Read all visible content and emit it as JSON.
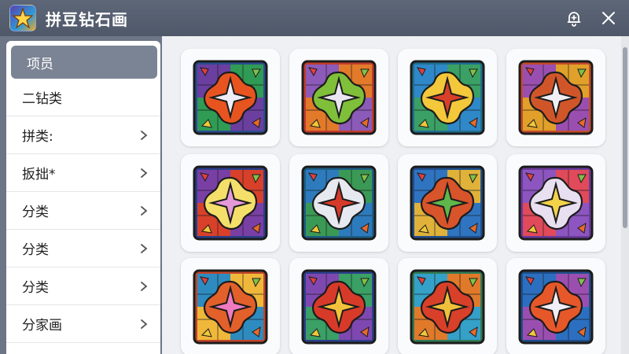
{
  "window": {
    "title": "拼豆钻石画",
    "icons": {
      "app": "app-star-icon",
      "bell": "bell-plus-icon",
      "close": "close-icon"
    }
  },
  "sidebar": {
    "items": [
      {
        "label": "项员",
        "active": true,
        "has_chevron": false
      },
      {
        "label": "二钻类",
        "active": false,
        "has_chevron": false
      },
      {
        "label": "拼类:",
        "active": false,
        "has_chevron": true
      },
      {
        "label": "扳拙*",
        "active": false,
        "has_chevron": true
      },
      {
        "label": "分类",
        "active": false,
        "has_chevron": true
      },
      {
        "label": "分类",
        "active": false,
        "has_chevron": true
      },
      {
        "label": "分类",
        "active": false,
        "has_chevron": true
      },
      {
        "label": "分家画",
        "active": false,
        "has_chevron": true
      }
    ]
  },
  "grid": {
    "tiles": [
      {
        "frame": "#2a4d8f",
        "star": "#f0eef5",
        "blob": "#e8541f",
        "bg1": "#6a3fa0",
        "bg2": "#2f9b55"
      },
      {
        "frame": "#c23b2b",
        "star": "#e9e6f2",
        "blob": "#7fbf3a",
        "bg1": "#8c5ab8",
        "bg2": "#e27a2a"
      },
      {
        "frame": "#1f6e8f",
        "star": "#d8402a",
        "blob": "#f3c83a",
        "bg1": "#2f88c8",
        "bg2": "#3aa065"
      },
      {
        "frame": "#c44a2a",
        "star": "#f1eff6",
        "blob": "#d0562a",
        "bg1": "#9a4fb0",
        "bg2": "#e0a02a"
      },
      {
        "frame": "#2a3e8a",
        "star": "#e49ad8",
        "blob": "#f4df6a",
        "bg1": "#7a3fa5",
        "bg2": "#d8402a"
      },
      {
        "frame": "#1c5f86",
        "star": "#d63a2a",
        "blob": "#e6e9ef",
        "bg1": "#2d7bbd",
        "bg2": "#3a9a55"
      },
      {
        "frame": "#1f4f8e",
        "star": "#5fb64a",
        "blob": "#d8542a",
        "bg1": "#2f74c0",
        "bg2": "#e0b23a"
      },
      {
        "frame": "#6a3a9a",
        "star": "#f3d24a",
        "blob": "#e8e0f0",
        "bg1": "#8d55c0",
        "bg2": "#e04a5a"
      },
      {
        "frame": "#c2452a",
        "star": "#f07ac0",
        "blob": "#e2602a",
        "bg1": "#2e8bc0",
        "bg2": "#f0b83a"
      },
      {
        "frame": "#2c3f8c",
        "star": "#f4c23a",
        "blob": "#d83a2a",
        "bg1": "#7f48b0",
        "bg2": "#3aa065"
      },
      {
        "frame": "#2f7a55",
        "star": "#f0c03a",
        "blob": "#d8402a",
        "bg1": "#35a0c8",
        "bg2": "#e07a2a"
      },
      {
        "frame": "#1e4e8a",
        "star": "#f2eef6",
        "blob": "#e6582a",
        "bg1": "#2c6fc0",
        "bg2": "#9a4fb0"
      }
    ]
  }
}
